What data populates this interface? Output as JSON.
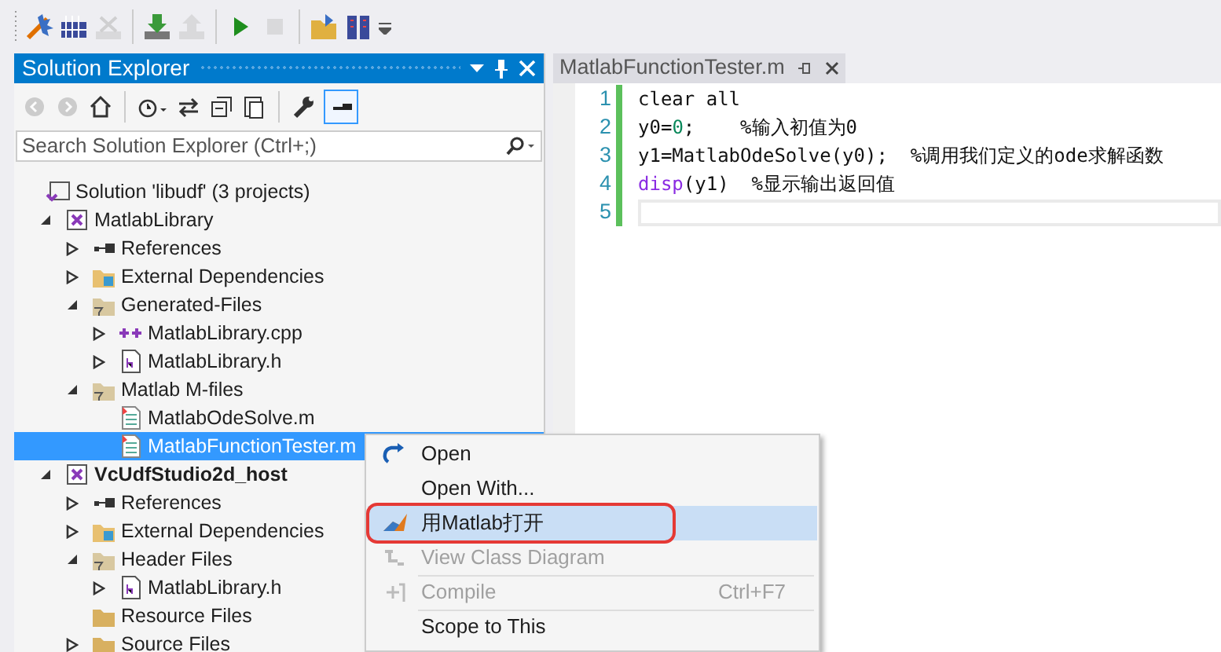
{
  "toolbar": [
    {
      "kind": "grip"
    },
    {
      "kind": "wizard",
      "disabled": false
    },
    {
      "kind": "grid",
      "disabled": false
    },
    {
      "kind": "delete",
      "disabled": true
    },
    {
      "kind": "separator"
    },
    {
      "kind": "download",
      "disabled": false
    },
    {
      "kind": "upload",
      "disabled": true
    },
    {
      "kind": "separator"
    },
    {
      "kind": "play",
      "disabled": false
    },
    {
      "kind": "stop",
      "disabled": true
    },
    {
      "kind": "separator"
    },
    {
      "kind": "folder",
      "disabled": false
    },
    {
      "kind": "books",
      "disabled": false
    },
    {
      "kind": "overflow",
      "disabled": false
    }
  ],
  "solution_explorer": {
    "title": "Solution Explorer",
    "toolbar": [
      {
        "kind": "back",
        "disabled": true,
        "selected": false
      },
      {
        "kind": "forward",
        "disabled": true,
        "selected": false
      },
      {
        "kind": "home",
        "disabled": false,
        "selected": false
      },
      {
        "kind": "separator"
      },
      {
        "kind": "history",
        "disabled": false,
        "selected": false
      },
      {
        "kind": "sync",
        "disabled": false,
        "selected": false
      },
      {
        "kind": "collapse",
        "disabled": false,
        "selected": false
      },
      {
        "kind": "copy",
        "disabled": false,
        "selected": false
      },
      {
        "kind": "separator"
      },
      {
        "kind": "wrench",
        "disabled": false,
        "selected": false
      },
      {
        "kind": "preview",
        "disabled": false,
        "selected": true
      }
    ],
    "search": {
      "placeholder": "Search Solution Explorer (Ctrl+;)"
    },
    "tree": [
      {
        "label": "Solution 'libudf' (3 projects)",
        "kind": "solution",
        "selected": false,
        "bold": false,
        "children": [
          {
            "label": "MatlabLibrary",
            "kind": "project",
            "expanded": true,
            "selected": false,
            "bold": false,
            "children": [
              {
                "label": "References",
                "kind": "references",
                "expanded": false,
                "selected": false,
                "bold": false
              },
              {
                "label": "External Dependencies",
                "kind": "dependencies",
                "expanded": false,
                "selected": false,
                "bold": false
              },
              {
                "label": "Generated-Files",
                "kind": "filter",
                "expanded": true,
                "selected": false,
                "bold": false,
                "children": [
                  {
                    "label": "MatlabLibrary.cpp",
                    "kind": "cpp",
                    "expanded": false,
                    "selected": false,
                    "bold": false
                  },
                  {
                    "label": "MatlabLibrary.h",
                    "kind": "header",
                    "expanded": false,
                    "selected": false,
                    "bold": false
                  }
                ]
              },
              {
                "label": "Matlab M-files",
                "kind": "filter",
                "expanded": true,
                "selected": false,
                "bold": false,
                "children": [
                  {
                    "label": "MatlabOdeSolve.m",
                    "kind": "mfile",
                    "selected": false,
                    "bold": false
                  },
                  {
                    "label": "MatlabFunctionTester.m",
                    "kind": "mfile",
                    "selected": true,
                    "bold": false
                  }
                ]
              }
            ]
          },
          {
            "label": "VcUdfStudio2d_host",
            "kind": "project",
            "expanded": true,
            "selected": false,
            "bold": true,
            "children": [
              {
                "label": "References",
                "kind": "references",
                "expanded": false,
                "selected": false,
                "bold": false
              },
              {
                "label": "External Dependencies",
                "kind": "dependencies",
                "expanded": false,
                "selected": false,
                "bold": false
              },
              {
                "label": "Header Files",
                "kind": "filter",
                "expanded": true,
                "selected": false,
                "bold": false,
                "children": [
                  {
                    "label": "MatlabLibrary.h",
                    "kind": "header",
                    "expanded": false,
                    "selected": false,
                    "bold": false
                  }
                ]
              },
              {
                "label": "Resource Files",
                "kind": "folder",
                "selected": false,
                "bold": false
              },
              {
                "label": "Source Files",
                "kind": "folder",
                "expanded": false,
                "selected": false,
                "bold": false
              }
            ]
          }
        ]
      }
    ]
  },
  "editor": {
    "tab": {
      "label": "MatlabFunctionTester.m"
    },
    "lines": [
      {
        "number": "1",
        "current": false,
        "segments": [
          {
            "kind": "plain",
            "text": "clear all"
          }
        ]
      },
      {
        "number": "2",
        "current": false,
        "segments": [
          {
            "kind": "plain",
            "text": "y0="
          },
          {
            "kind": "number",
            "text": "0"
          },
          {
            "kind": "plain",
            "text": ";    %输入初值为0"
          }
        ]
      },
      {
        "number": "3",
        "current": false,
        "segments": [
          {
            "kind": "plain",
            "text": "y1=MatlabOdeSolve(y0);  %调用我们定义的ode求解函数"
          }
        ]
      },
      {
        "number": "4",
        "current": false,
        "segments": [
          {
            "kind": "function",
            "text": "disp"
          },
          {
            "kind": "plain",
            "text": "(y1)  %显示输出返回值"
          }
        ]
      },
      {
        "number": "5",
        "current": true
      }
    ]
  },
  "context_menu": [
    {
      "label": "Open",
      "kind": "open",
      "disabled": false,
      "selected": false,
      "annotated": false,
      "separator_before": false
    },
    {
      "label": "Open With...",
      "kind": "plain",
      "disabled": false,
      "selected": false,
      "annotated": false,
      "separator_before": false
    },
    {
      "label": "用Matlab打开",
      "kind": "matlab",
      "disabled": false,
      "selected": true,
      "annotated": true,
      "separator_before": false
    },
    {
      "label": "View Class Diagram",
      "kind": "diagram",
      "disabled": true,
      "selected": false,
      "annotated": false,
      "separator_before": false
    },
    {
      "label": "Compile",
      "kind": "compile",
      "shortcut": "Ctrl+F7",
      "disabled": true,
      "selected": false,
      "annotated": false,
      "separator_before": true
    },
    {
      "label": "Scope to This",
      "kind": "plain",
      "disabled": false,
      "selected": false,
      "annotated": false,
      "separator_before": true
    }
  ]
}
